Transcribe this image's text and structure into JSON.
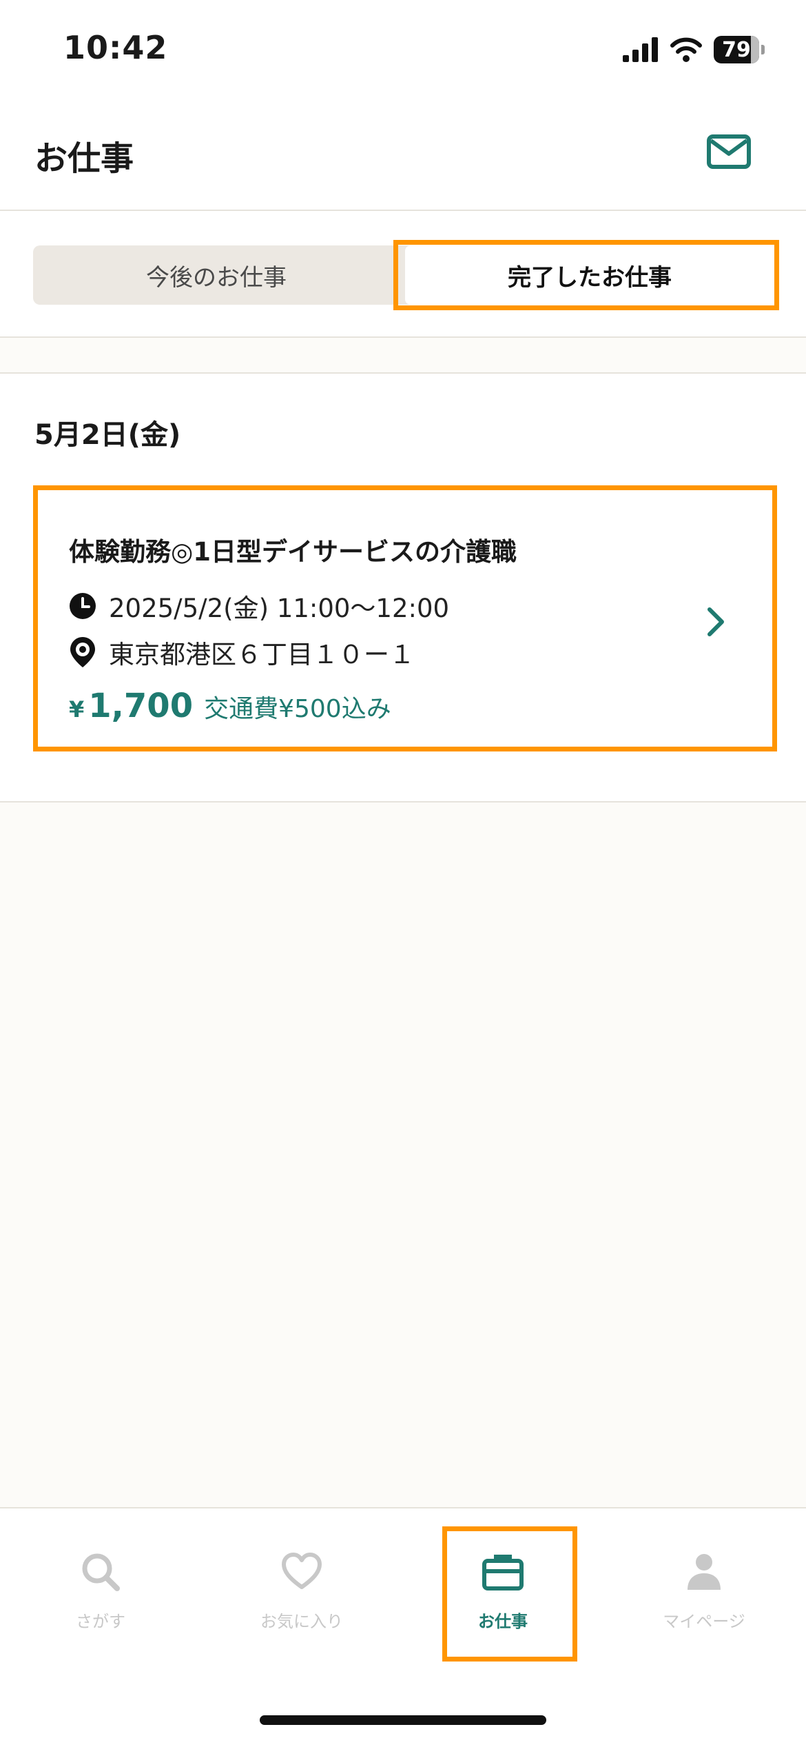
{
  "status_bar": {
    "time": "10:42",
    "battery": "79"
  },
  "header": {
    "title": "お仕事"
  },
  "segment": {
    "upcoming_label": "今後のお仕事",
    "completed_label": "完了したお仕事",
    "selected": "completed"
  },
  "date_group": {
    "date": "5月2日(金)"
  },
  "job": {
    "title": "体験勤務◎1日型デイサービスの介護職",
    "datetime": "2025/5/2(金) 11:00〜12:00",
    "location": "東京都港区６丁目１０ー１",
    "wage_symbol": "¥",
    "wage_amount": "1,700",
    "fare_note": "交通費¥500込み"
  },
  "tab_bar": {
    "items": [
      {
        "label": "さがす",
        "icon": "search-icon"
      },
      {
        "label": "お気に入り",
        "icon": "heart-icon"
      },
      {
        "label": "お仕事",
        "icon": "briefcase-icon",
        "active": true
      },
      {
        "label": "マイページ",
        "icon": "person-icon"
      }
    ]
  },
  "colors": {
    "accent": "#1f7a70",
    "highlight": "#ff9500",
    "inactive": "#c8c8c8"
  }
}
